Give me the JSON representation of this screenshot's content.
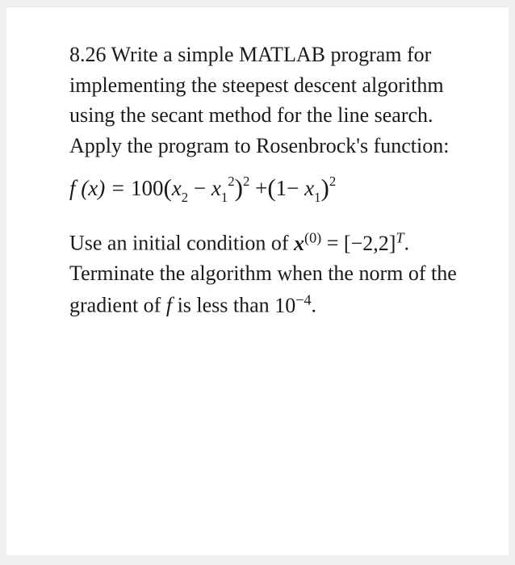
{
  "problem": {
    "number": "8.26",
    "intro": "Write a simple MATLAB program for implementing the steepest descent algorithm using the secant method for the line search. Apply the program to Rosenbrock's function:",
    "formula": {
      "lhs": "f (x) =",
      "coeff": "100",
      "term1_inner_a": "x",
      "term1_inner_a_sub": "2",
      "minus1": "−",
      "term1_inner_b": "x",
      "term1_inner_b_sub": "1",
      "term1_inner_b_sup": "2",
      "term1_outer_sup": "2",
      "plus": "+",
      "term2_inner_a": "1",
      "minus2": "−",
      "term2_inner_b": "x",
      "term2_inner_b_sub": "1",
      "term2_outer_sup": "2"
    },
    "para2_a": "Use an initial condition of ",
    "x0_sym": "x",
    "x0_sup": "(0)",
    "para2_b": " = ",
    "x0_val": "[−2,2]",
    "x0_T": "T",
    "para2_c": ". Terminate the algorithm when the norm of the gradient of ",
    "f_sym": "f",
    "para2_d": " is less than ",
    "tol_base": "10",
    "tol_exp": "−4",
    "para2_e": "."
  }
}
